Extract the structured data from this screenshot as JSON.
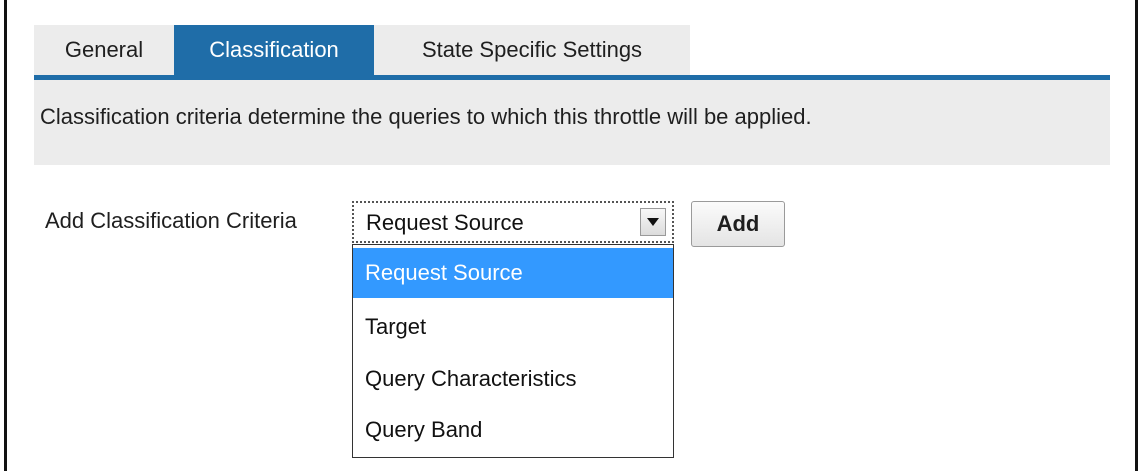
{
  "tabs": [
    {
      "label": "General",
      "active": false
    },
    {
      "label": "Classification",
      "active": true
    },
    {
      "label": "State Specific Settings",
      "active": false
    }
  ],
  "description": "Classification criteria determine the queries to which this throttle will be applied.",
  "criteria": {
    "label": "Add Classification Criteria",
    "selected_value": "Request Source",
    "arrow_icon": "triangle-down-icon",
    "add_button_label": "Add",
    "options": [
      {
        "label": "Request Source",
        "highlighted": true
      },
      {
        "label": "Target",
        "highlighted": false
      },
      {
        "label": "Query Characteristics",
        "highlighted": false
      },
      {
        "label": "Query Band",
        "highlighted": false
      }
    ]
  },
  "colors": {
    "active_tab": "#1f6da8",
    "panel_background": "#ececec",
    "option_highlight": "#3399ff"
  }
}
